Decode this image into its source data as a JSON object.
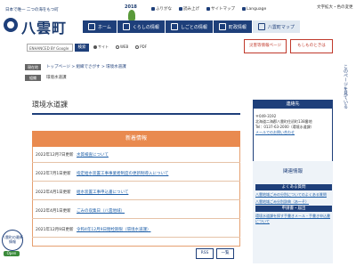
{
  "header": {
    "tagline": "日本で唯一 二つの海をもつ町",
    "logo_text": "八雲町",
    "badge": "2018",
    "util_nav": [
      {
        "label": "ふりがな",
        "icon": "kana-icon"
      },
      {
        "label": "読み上げ",
        "icon": "speaker-icon"
      },
      {
        "label": "サイトマップ",
        "icon": "sitemap-icon"
      },
      {
        "label": "Language",
        "icon": "globe-icon"
      }
    ],
    "font_size_label": "文字拡大・色の変更"
  },
  "nav": {
    "items": [
      {
        "label": "ホーム",
        "icon": "home-icon"
      },
      {
        "label": "くらしの情報",
        "icon": "house-icon"
      },
      {
        "label": "しごとの情報",
        "icon": "briefcase-icon"
      },
      {
        "label": "町政情報",
        "icon": "building-icon"
      },
      {
        "label": "八雲町マップ",
        "icon": "map-icon"
      }
    ]
  },
  "search": {
    "placeholder": "ENHANCED BY Google",
    "button_label": "検索",
    "radio_options": [
      "サイト",
      "WEB",
      "PDF"
    ]
  },
  "quick_links": {
    "emergency": "災害等情報ページ",
    "mobile": "もしものときは"
  },
  "breadcrumb": {
    "here_label": "現在地",
    "trail": "トップページ > 組織でさがす > 環境水道課",
    "dept_label": "組織",
    "dept_name": "環境水道課"
  },
  "main": {
    "title": "環境水道課",
    "news_header": "新着情報",
    "news": [
      {
        "date": "2022年12月7日更新",
        "title": "水質検査について"
      },
      {
        "date": "2022年7月1日更新",
        "title": "指定給水装置工事事業者制度の更新制導入について"
      },
      {
        "date": "2022年4月1日更新",
        "title": "給水装置工事申込書について"
      },
      {
        "date": "2022年4月1日更新",
        "title": "ごみの収集日（八雲地域）"
      },
      {
        "date": "2021年12月9日更新",
        "title": "令和4年12月9日閉栓期限（環境水道課）"
      }
    ],
    "rss_label": "RSS",
    "list_label": "一覧"
  },
  "contact": {
    "header": "連絡先",
    "lines": [
      "〒049-3192",
      "北海道二海郡八雲町住初町138番地",
      "Tel：0137-63-2000（環境水道課）",
      "メールでのお問い合わせ"
    ]
  },
  "related": {
    "header": "関連情報",
    "sections": [
      {
        "category": "よくある質問",
        "links": [
          "八雲地域ごみの分別についてのよくある質問",
          "八雲地域ごみ分別辞典（あ～そ）"
        ]
      },
      {
        "category": "申請書・届出",
        "links": [
          "環境水道課を探す手書きメール・手書き申込書について"
        ]
      }
    ]
  },
  "widgets": {
    "left_text": "八雲町の最新情報",
    "left_open": "Open",
    "right_text": "このページを見ている"
  }
}
